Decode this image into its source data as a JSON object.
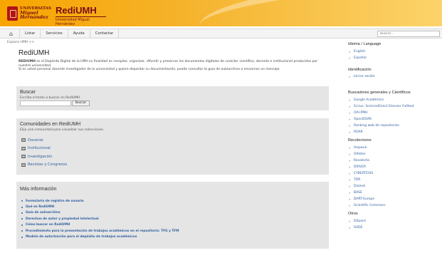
{
  "header": {
    "university_line1": "UNIVERSITAS",
    "university_line2": "Miguel",
    "university_line3": "Hernández",
    "app_name": "RediUMH",
    "app_subtitle": "Universidad Miguel Hernández"
  },
  "nav": {
    "items": [
      "Listar",
      "Servicios",
      "Ayuda",
      "Contactar"
    ],
    "search_placeholder": "Buscar..."
  },
  "breadcrumb": "Espacio UMH >>",
  "page": {
    "title": "RediUMH",
    "intro_bold": "REDIUMH",
    "intro_rest": " es el Depósito Digital de la UMH su finalidad es recopilar, organizar, difundir y preservar los documentos digitales de carácter científico, docente e institucional producidos por nuestra universidad.",
    "intro_line2": "Si es usted personal docente investigador de la universidad y quiere depositar su documentación, puede consultar la guía de autoarchivo o enviarnos un mensaje."
  },
  "buscar": {
    "title": "Buscar",
    "subtitle": "Escriba el texto a buscar en RediUMH",
    "button": "Buscar"
  },
  "comunidades": {
    "title": "Comunidades en RediUMH",
    "subtitle": "Elija una comunidad para visualizar sus colecciones.",
    "items": [
      "Docente",
      "Institucional",
      "Investigación",
      "Revistas y Congresos"
    ]
  },
  "mas_info": {
    "title": "Más información",
    "items": [
      "Formulario de registro de usuario",
      "Qué es RediUMH",
      "Guía de autoarchivo",
      "Derechos de autor y propiedad intelectual",
      "Cómo buscar en RediUMH",
      "Procedimiento para la presentación de trabajos académicos en el repositorio: TFG y TFM",
      "Modelo de autorización para el depósito de trabajos académicos"
    ]
  },
  "sidebar": {
    "idioma": {
      "title": "Idioma / Language",
      "items": [
        "English",
        "Español"
      ]
    },
    "identificacion": {
      "title": "Identificación",
      "items": [
        "Iniciar sesión"
      ]
    },
    "buscadores": {
      "title": "Buscadores generales y Científicos",
      "items": [
        "Google Académico",
        "Scirus: ScienceDirect Elsevier Fulltext",
        "OAI-PMH",
        "OpenDOAR",
        "Ranking web de repositories",
        "ROAR"
      ]
    },
    "recolectores": {
      "title": "Recolectores",
      "items": [
        "Hispana",
        "OAIster",
        "Recolecta",
        "DRIVER",
        "CYBERTESIS",
        "TDR",
        "Dialnet",
        "BASE",
        "DART-Europe",
        "Scientific Commons"
      ]
    },
    "otros": {
      "title": "Otros",
      "items": [
        "DSpace",
        "SUDE"
      ]
    }
  },
  "colors": {
    "banner": "#f7a500",
    "link": "#2f5fa0",
    "panel": "#e5e5e5",
    "brand": "#7a0b10"
  }
}
